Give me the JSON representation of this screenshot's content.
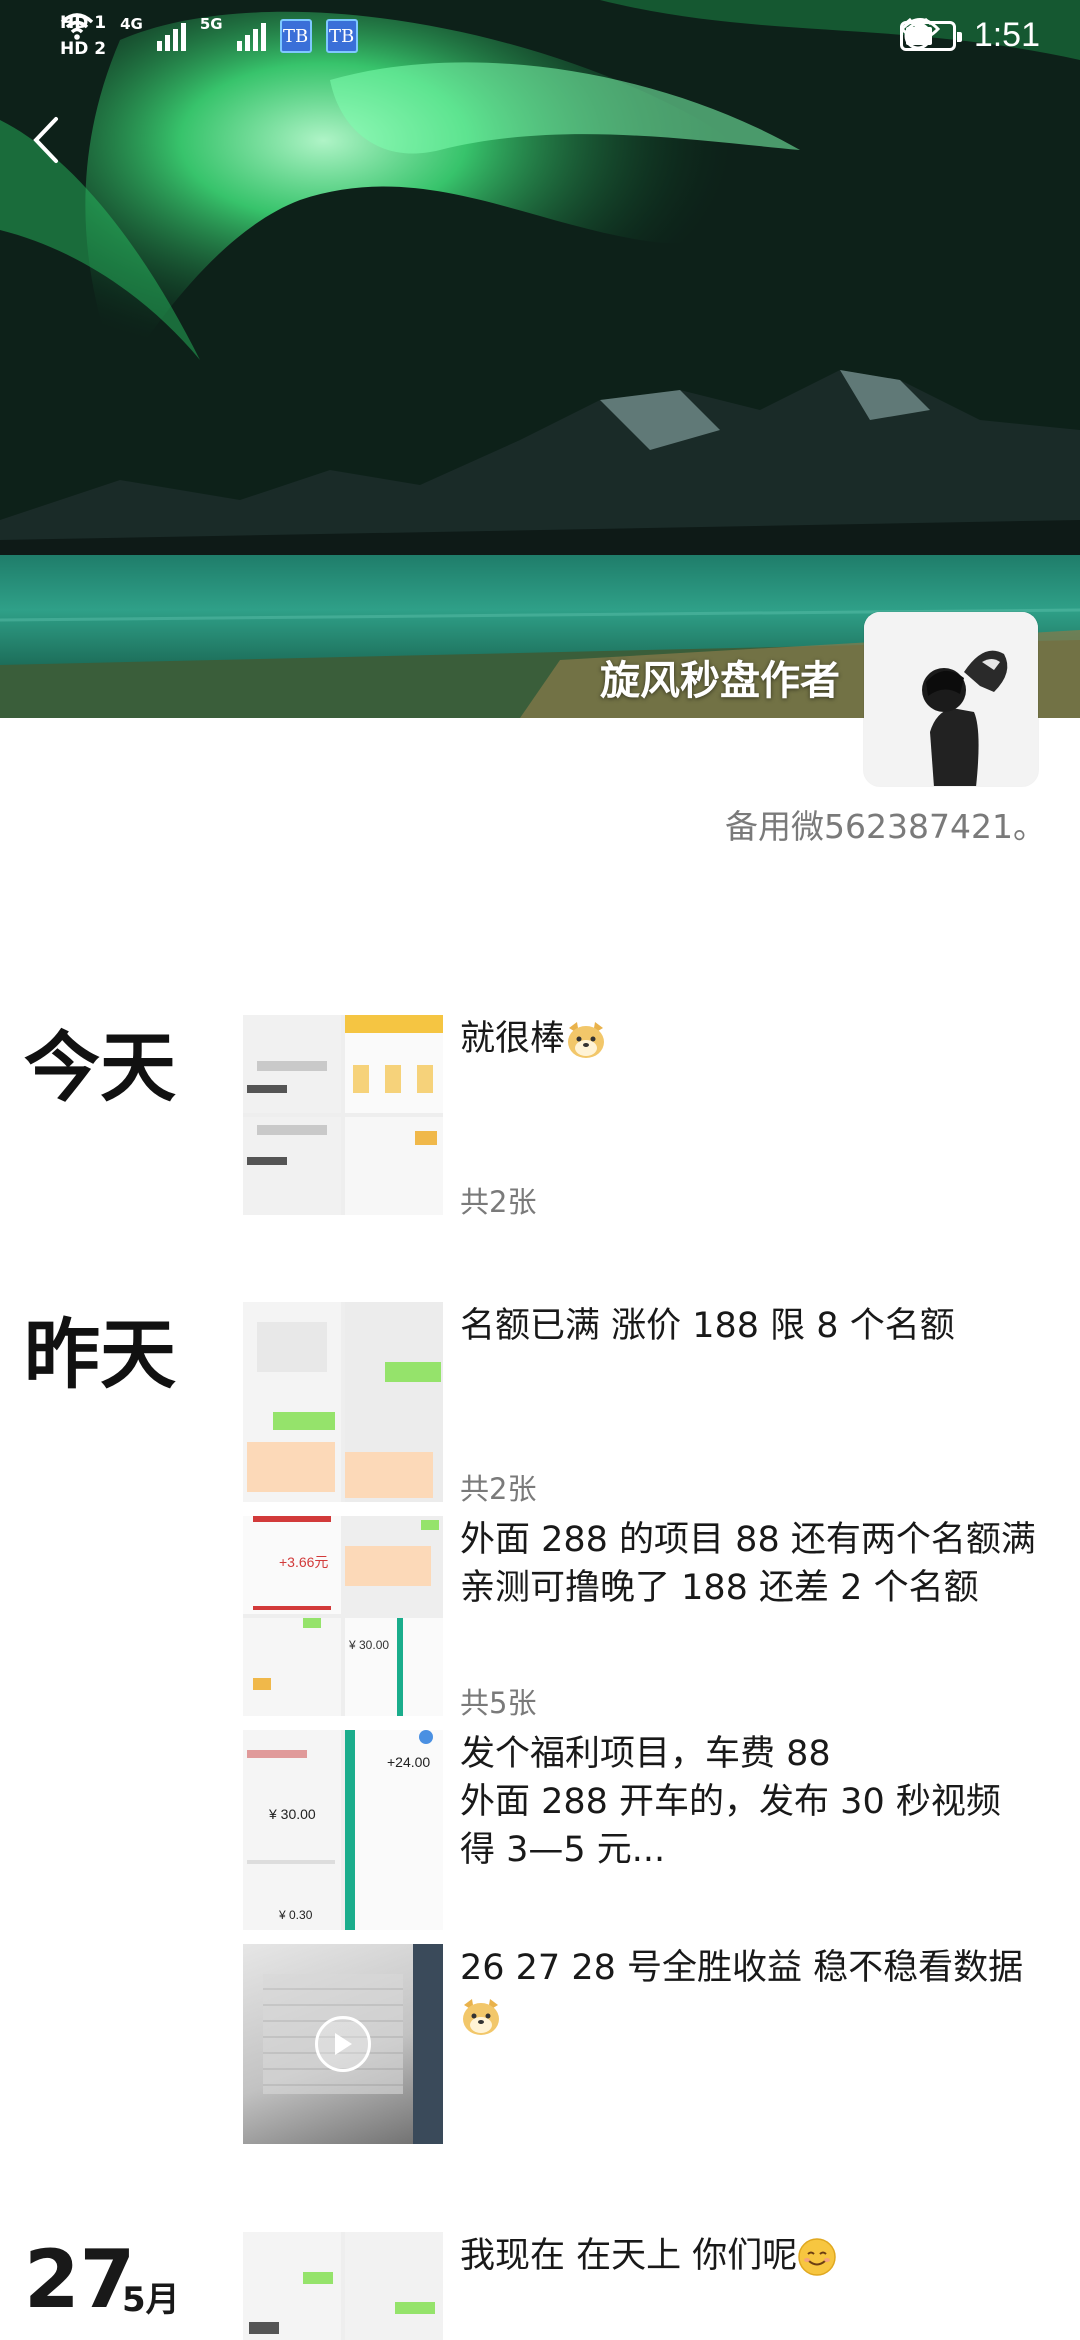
{
  "status_bar": {
    "hd1": "HD 1",
    "hd2": "HD 2",
    "net1": "4G",
    "net2": "5G",
    "tb1": "TB",
    "tb2": "TB",
    "time": "1:51",
    "battery_level": 0.6
  },
  "profile": {
    "nickname": "旋风秒盘作者",
    "signature": "备用微562387421。"
  },
  "groups": [
    {
      "date_label": "今天",
      "posts": [
        {
          "text": "就很棒",
          "emoji": "dog-emoji",
          "count": "共2张"
        }
      ]
    },
    {
      "date_label": "昨天",
      "posts": [
        {
          "text": "名额已满 涨价 188 限 8 个名额",
          "count": "共2张"
        },
        {
          "text": "外面 288 的项目 88 还有两个名额满\n亲测可撸晚了 188 还差 2 个名额",
          "count": "共5张"
        },
        {
          "text": "发个福利项目，车费 88\n外面 288 开车的，发布 30 秒视频\n得 3—5 元...",
          "count": ""
        },
        {
          "text": "26 27 28 号全胜收益 稳不稳看数据",
          "emoji": "dog-emoji",
          "count": ""
        }
      ]
    },
    {
      "date_day": "27",
      "date_month": "5月",
      "posts": [
        {
          "text": "我现在 在天上 你们呢",
          "emoji": "smile-emoji",
          "count": ""
        }
      ]
    }
  ],
  "thumb_texts": {
    "t1_amount": "¥ 30.00",
    "t1_small": "¥ 0.30",
    "t2_amount": "+24.00",
    "t3_amount": "+3.66元",
    "t3_small": "¥ 30.00"
  }
}
